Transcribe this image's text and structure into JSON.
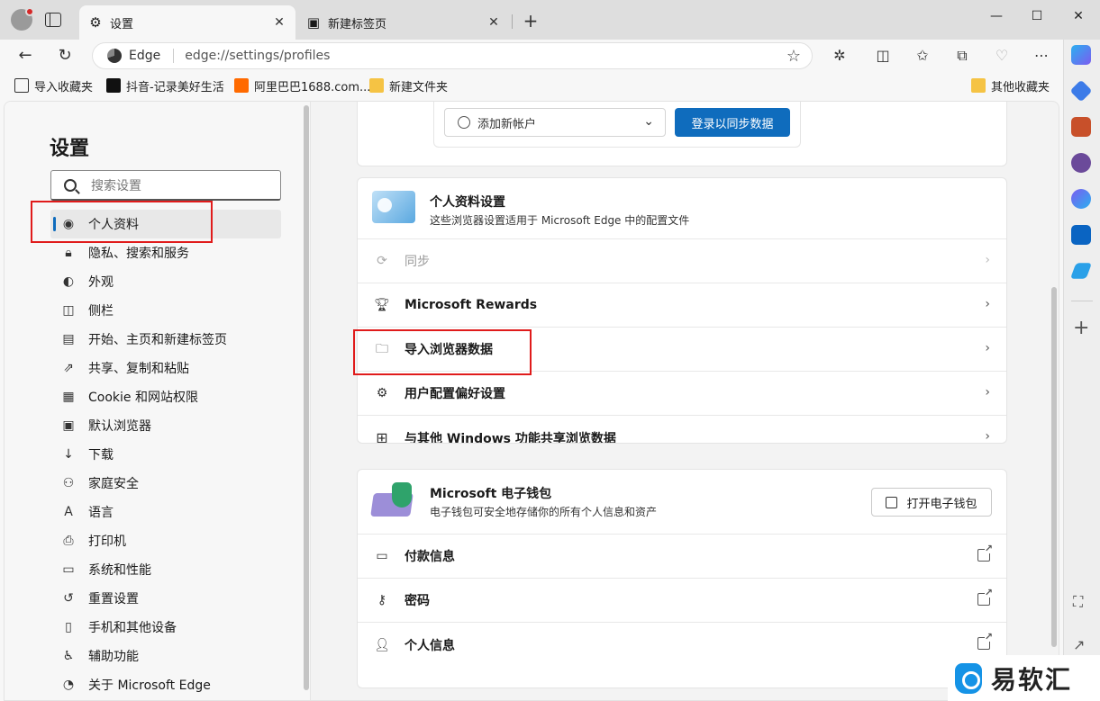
{
  "tabs": [
    {
      "label": "设置",
      "icon": "gear-icon"
    },
    {
      "label": "新建标签页",
      "icon": "new-tab-page-icon"
    }
  ],
  "window": {
    "minimize": "—",
    "maximize": "☐",
    "close": "✕"
  },
  "address": {
    "brand": "Edge",
    "url": "edge://settings/profiles"
  },
  "bookmarks": [
    {
      "label": "导入收藏夹"
    },
    {
      "label": "抖音-记录美好生活"
    },
    {
      "label": "阿里巴巴1688.com..."
    },
    {
      "label": "新建文件夹"
    },
    {
      "label": "其他收藏夹"
    }
  ],
  "sidebar": {
    "title": "设置",
    "search_placeholder": "搜索设置",
    "items": [
      {
        "label": "个人资料",
        "icon": "profile-icon",
        "active": true
      },
      {
        "label": "隐私、搜索和服务",
        "icon": "lock-icon"
      },
      {
        "label": "外观",
        "icon": "palette-icon"
      },
      {
        "label": "侧栏",
        "icon": "sidebar-icon"
      },
      {
        "label": "开始、主页和新建标签页",
        "icon": "home-icon"
      },
      {
        "label": "共享、复制和粘贴",
        "icon": "share-icon"
      },
      {
        "label": "Cookie 和网站权限",
        "icon": "cookie-icon"
      },
      {
        "label": "默认浏览器",
        "icon": "browser-icon"
      },
      {
        "label": "下载",
        "icon": "download-icon"
      },
      {
        "label": "家庭安全",
        "icon": "family-icon"
      },
      {
        "label": "语言",
        "icon": "language-icon"
      },
      {
        "label": "打印机",
        "icon": "printer-icon"
      },
      {
        "label": "系统和性能",
        "icon": "system-icon"
      },
      {
        "label": "重置设置",
        "icon": "reset-icon"
      },
      {
        "label": "手机和其他设备",
        "icon": "phone-icon"
      },
      {
        "label": "辅助功能",
        "icon": "accessibility-icon"
      },
      {
        "label": "关于 Microsoft Edge",
        "icon": "edge-icon"
      }
    ]
  },
  "account": {
    "add_account": "添加新帐户",
    "sign_in": "登录以同步数据"
  },
  "profile_settings": {
    "title": "个人资料设置",
    "subtitle": "这些浏览器设置适用于 Microsoft Edge 中的配置文件",
    "rows": [
      {
        "label": "同步",
        "icon": "sync-icon",
        "disabled": true
      },
      {
        "label": "Microsoft Rewards",
        "icon": "rewards-icon"
      },
      {
        "label": "导入浏览器数据",
        "icon": "import-folder-icon"
      },
      {
        "label": "用户配置偏好设置",
        "icon": "user-settings-icon"
      },
      {
        "label": "与其他 Windows 功能共享浏览数据",
        "icon": "windows-icon"
      }
    ]
  },
  "wallet": {
    "title": "Microsoft 电子钱包",
    "subtitle": "电子钱包可安全地存储你的所有个人信息和资产",
    "open_button": "打开电子钱包",
    "rows": [
      {
        "label": "付款信息",
        "icon": "card-icon"
      },
      {
        "label": "密码",
        "icon": "key-icon"
      },
      {
        "label": "个人信息",
        "icon": "personal-info-icon"
      }
    ]
  },
  "watermark": {
    "text": "易软汇"
  },
  "colors": {
    "accent": "#0f6cbd",
    "highlight": "#e01b1b"
  }
}
